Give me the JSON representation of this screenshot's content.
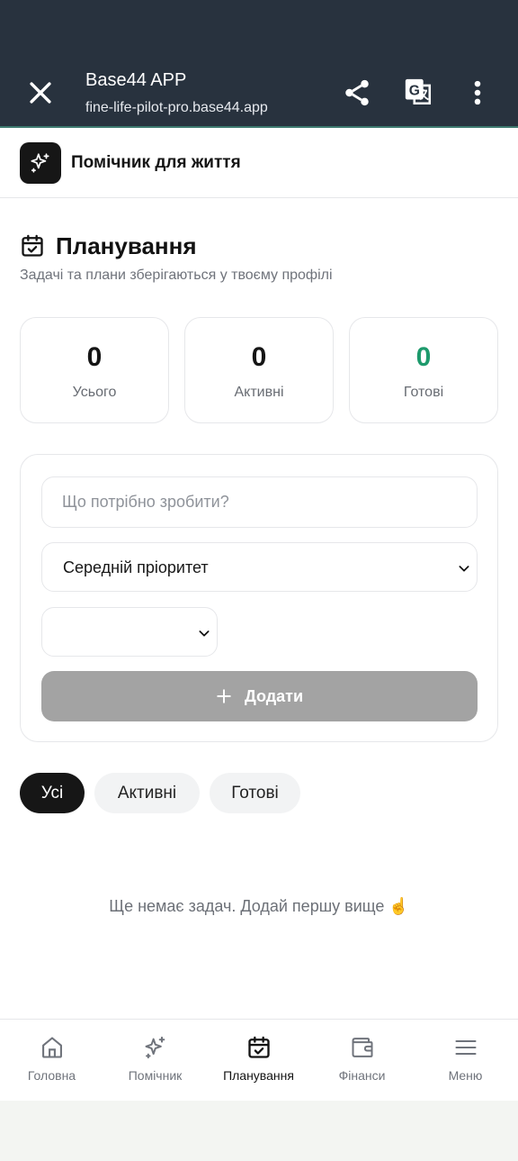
{
  "browser": {
    "title": "Base44 APP",
    "url": "fine-life-pilot-pro.base44.app"
  },
  "app": {
    "name": "Помічник для життя"
  },
  "page": {
    "title": "Планування",
    "subtitle": "Задачі та плани зберігаються у твоєму профілі"
  },
  "stats": [
    {
      "value": "0",
      "label": "Усього"
    },
    {
      "value": "0",
      "label": "Активні"
    },
    {
      "value": "0",
      "label": "Готові"
    }
  ],
  "form": {
    "task_placeholder": "Що потрібно зробити?",
    "task_value": "",
    "priority_value": "Середній пріоритет",
    "date_value": "",
    "add_label": "Додати"
  },
  "filters": [
    {
      "label": "Усі",
      "selected": true
    },
    {
      "label": "Активні",
      "selected": false
    },
    {
      "label": "Готові",
      "selected": false
    }
  ],
  "empty_state": "Ще немає задач. Додай першу вище ☝️",
  "nav": [
    {
      "label": "Головна",
      "icon": "home-icon"
    },
    {
      "label": "Помічник",
      "icon": "sparkles-icon"
    },
    {
      "label": "Планування",
      "icon": "calendar-check-icon",
      "current": true
    },
    {
      "label": "Фінанси",
      "icon": "wallet-icon"
    },
    {
      "label": "Меню",
      "icon": "menu-icon"
    }
  ],
  "colors": {
    "browser_bar": "#28323e",
    "accent_done": "#1d9a6c",
    "primary": "#161616",
    "button_disabled": "#a3a3a3"
  }
}
